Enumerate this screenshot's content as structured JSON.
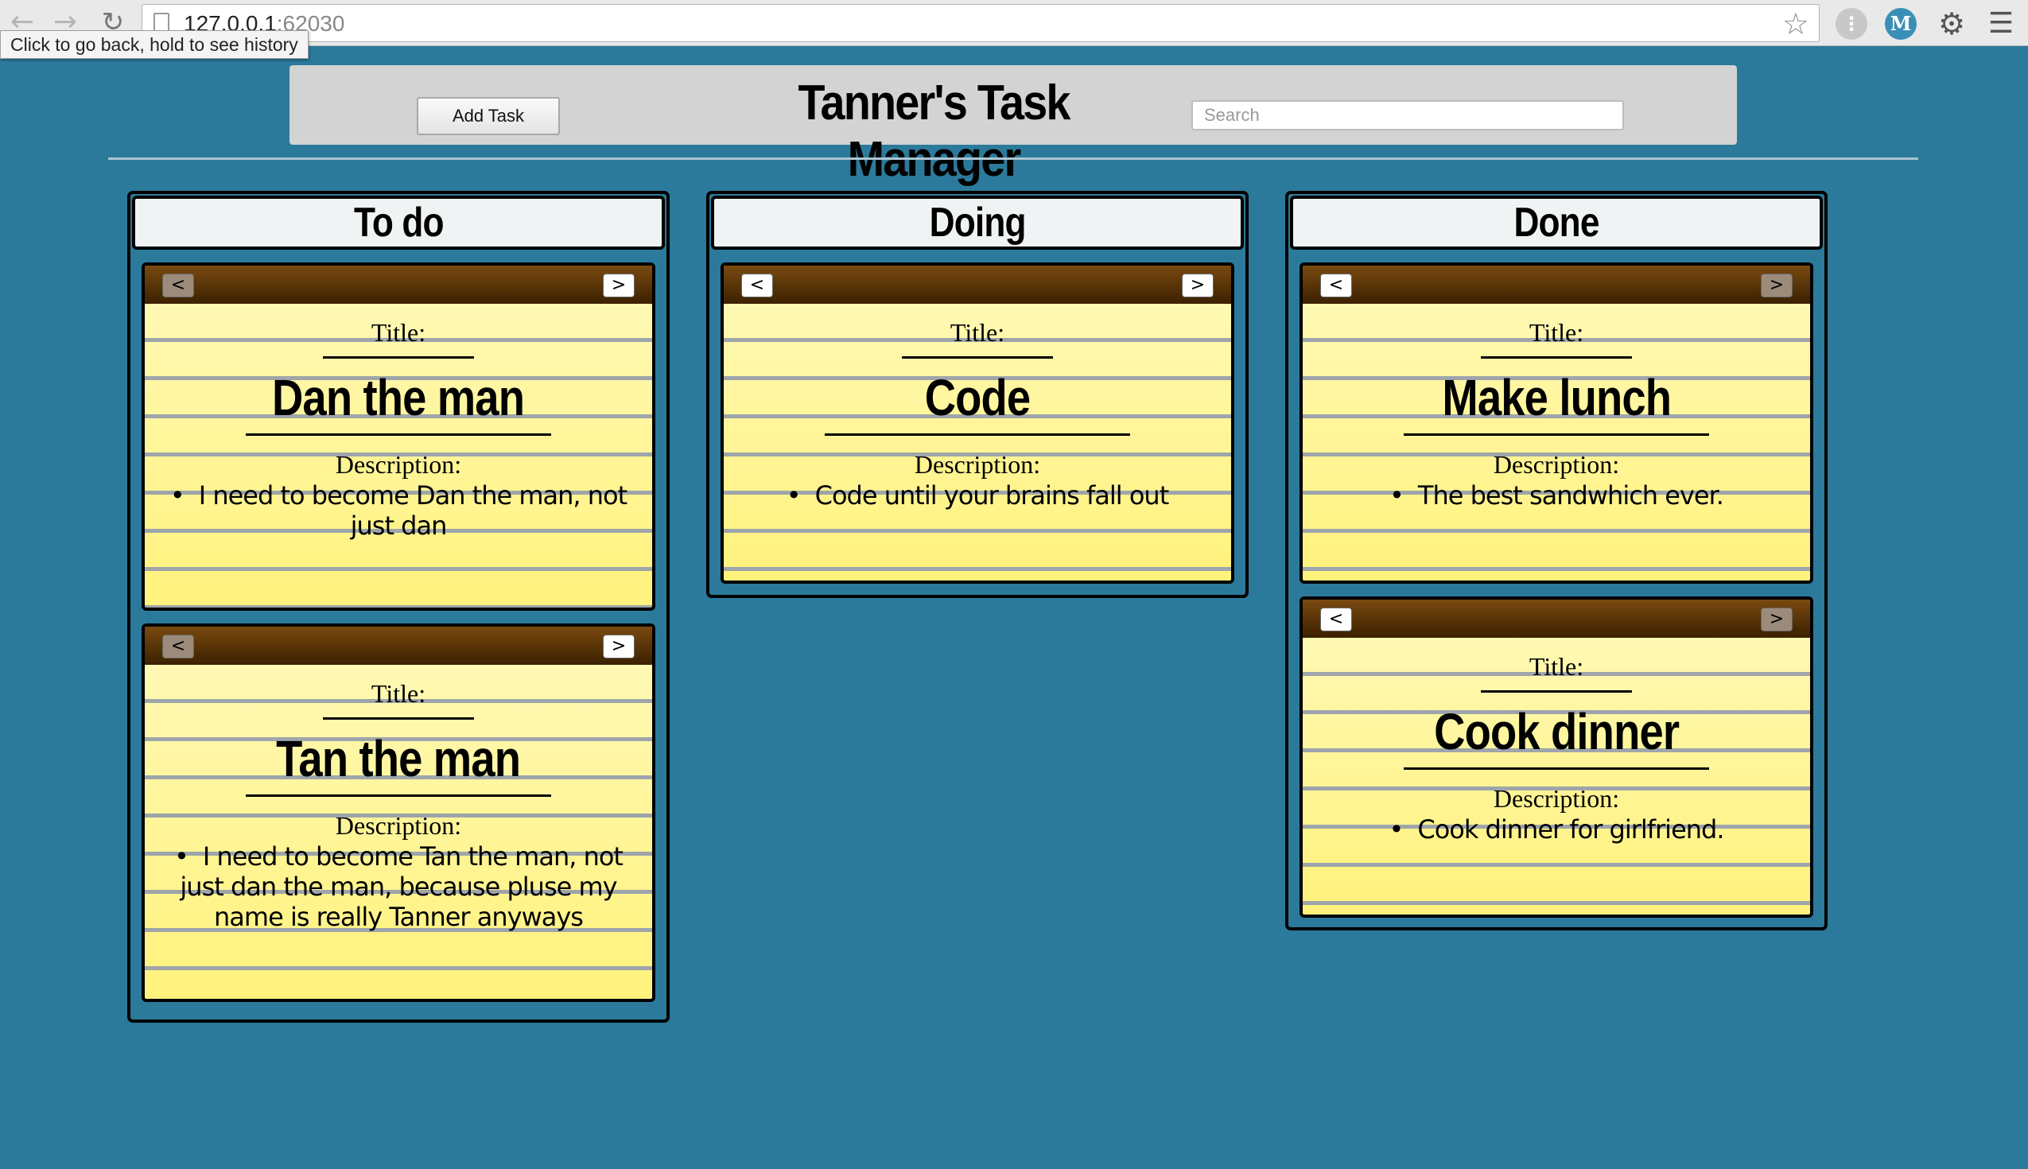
{
  "browser": {
    "url_host": "127.0.0.1",
    "url_port": ":62030",
    "tooltip": "Click to go back, hold to see history"
  },
  "header": {
    "title": "Tanner's Task Manager",
    "add_task_label": "Add Task",
    "search_placeholder": "Search"
  },
  "columns": [
    {
      "name": "To do",
      "tasks": [
        {
          "title_label": "Title:",
          "title": "Dan the man",
          "description_label": "Description:",
          "description": "I need to become Dan the man, not just dan",
          "prev": "<",
          "next": ">"
        },
        {
          "title_label": "Title:",
          "title": "Tan the man",
          "description_label": "Description:",
          "description": "I need to become Tan the man, not just dan the man, because pluse my name is really Tanner anyways",
          "prev": "<",
          "next": ">"
        }
      ]
    },
    {
      "name": "Doing",
      "tasks": [
        {
          "title_label": "Title:",
          "title": "Code",
          "description_label": "Description:",
          "description": "Code until your brains fall out",
          "prev": "<",
          "next": ">"
        }
      ]
    },
    {
      "name": "Done",
      "tasks": [
        {
          "title_label": "Title:",
          "title": "Make lunch",
          "description_label": "Description:",
          "description": "The best sandwhich ever.",
          "prev": "<",
          "next": ">"
        },
        {
          "title_label": "Title:",
          "title": "Cook dinner",
          "description_label": "Description:",
          "description": "Cook dinner for girlfriend.",
          "prev": "<",
          "next": ">"
        }
      ]
    }
  ],
  "colors": {
    "background": "#2c7a9b",
    "card_top": "#5a3400",
    "card_paper": "#fff27c"
  }
}
